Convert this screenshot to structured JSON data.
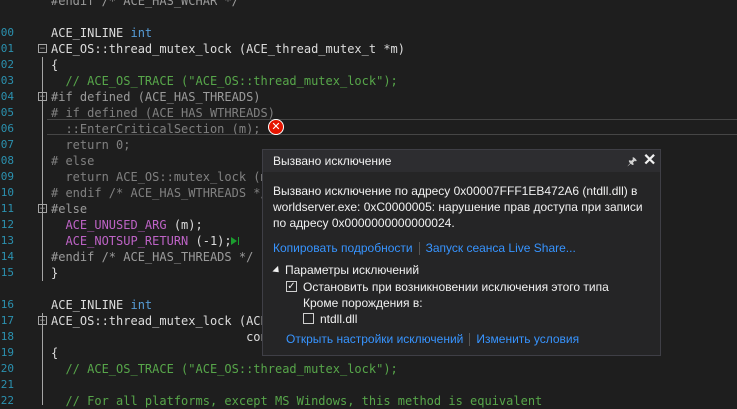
{
  "editor": {
    "lines": [
      {
        "n": "",
        "fold": "",
        "segs": [
          {
            "c": "pp",
            "t": "#endif /* ACE_HAS_WCHAR */"
          }
        ]
      },
      {
        "n": "",
        "fold": "",
        "segs": []
      },
      {
        "n": "00",
        "fold": "",
        "segs": [
          {
            "c": "",
            "t": "ACE_INLINE "
          },
          {
            "c": "kw",
            "t": "int"
          }
        ]
      },
      {
        "n": "01",
        "fold": "−",
        "segs": [
          {
            "c": "",
            "t": "ACE_OS::thread_mutex_lock (ACE_thread_mutex_t *m)"
          }
        ]
      },
      {
        "n": "02",
        "fold": "",
        "segs": [
          {
            "c": "",
            "t": "{"
          }
        ]
      },
      {
        "n": "03",
        "fold": "",
        "segs": [
          {
            "c": "cm",
            "t": "  // ACE_OS_TRACE (\"ACE_OS::thread_mutex_lock\");"
          }
        ]
      },
      {
        "n": "04",
        "fold": "−",
        "segs": [
          {
            "c": "pp",
            "t": "#if defined (ACE_HAS_THREADS)"
          }
        ]
      },
      {
        "n": "05",
        "fold": "",
        "segs": [
          {
            "c": "gr",
            "t": "# if defined (ACE_HAS_WTHREADS)"
          }
        ]
      },
      {
        "n": "06",
        "fold": "",
        "segs": [
          {
            "c": "gr",
            "t": "  ::EnterCriticalSection (m);"
          }
        ]
      },
      {
        "n": "07",
        "fold": "",
        "segs": [
          {
            "c": "gr",
            "t": "  return 0;"
          }
        ]
      },
      {
        "n": "08",
        "fold": "",
        "segs": [
          {
            "c": "gr",
            "t": "# else"
          }
        ]
      },
      {
        "n": "09",
        "fold": "",
        "segs": [
          {
            "c": "gr",
            "t": "  return ACE_OS::mutex_lock (m"
          }
        ]
      },
      {
        "n": "10",
        "fold": "",
        "segs": [
          {
            "c": "gr",
            "t": "# endif /* ACE_HAS_WTHREADS */"
          }
        ]
      },
      {
        "n": "11",
        "fold": "−",
        "segs": [
          {
            "c": "pp",
            "t": "#else"
          }
        ]
      },
      {
        "n": "12",
        "fold": "",
        "segs": [
          {
            "c": "mac",
            "t": "  ACE_UNUSED_ARG"
          },
          {
            "c": "",
            "t": " (m);"
          }
        ]
      },
      {
        "n": "13",
        "fold": "",
        "segs": [
          {
            "c": "mac",
            "t": "  ACE_NOTSUP_RETURN"
          },
          {
            "c": "",
            "t": " (-1);"
          }
        ]
      },
      {
        "n": "14",
        "fold": "",
        "segs": [
          {
            "c": "pp",
            "t": "#endif /* ACE_HAS_THREADS */"
          }
        ]
      },
      {
        "n": "15",
        "fold": "",
        "segs": [
          {
            "c": "",
            "t": "}"
          }
        ]
      },
      {
        "n": "",
        "fold": "",
        "segs": []
      },
      {
        "n": "16",
        "fold": "",
        "segs": [
          {
            "c": "",
            "t": "ACE_INLINE "
          },
          {
            "c": "kw",
            "t": "int"
          }
        ]
      },
      {
        "n": "17",
        "fold": "−",
        "segs": [
          {
            "c": "",
            "t": "ACE_OS::thread_mutex_lock (ACE"
          }
        ]
      },
      {
        "n": "18",
        "fold": "",
        "segs": [
          {
            "c": "",
            "t": "                           con"
          }
        ]
      },
      {
        "n": "19",
        "fold": "",
        "segs": [
          {
            "c": "",
            "t": "{"
          }
        ]
      },
      {
        "n": "20",
        "fold": "",
        "segs": [
          {
            "c": "cm",
            "t": "  // ACE_OS_TRACE (\"ACE_OS::thread_mutex_lock\");"
          }
        ]
      },
      {
        "n": "21",
        "fold": "",
        "segs": []
      },
      {
        "n": "22",
        "fold": "",
        "segs": [
          {
            "c": "cm",
            "t": "  // For all platforms, except MS Windows, this method is equivalent"
          }
        ]
      }
    ]
  },
  "icons": {
    "error": "error-circle-icon",
    "next_statement": "next-statement-arrow-icon"
  },
  "popup": {
    "title": "Вызвано исключение",
    "pin_icon": "pin-icon",
    "close_icon": "close-icon",
    "message_line1": "Вызвано исключение по адресу 0x00007FFF1EB472A6 (ntdll.dll) в",
    "message_line2": "worldserver.exe: 0xC0000005: нарушение прав доступа при записи",
    "message_line3": "по адресу 0x0000000000000024.",
    "copy_details": "Копировать подробности",
    "live_share": "Запуск сеанса Live Share...",
    "section_title": "Параметры исключений",
    "break_when_thrown": "Остановить при возникновении исключения этого типа",
    "break_checked": true,
    "except_when": "Кроме порождения в:",
    "ntdll_label": "ntdll.dll",
    "ntdll_checked": false,
    "open_settings": "Открыть настройки исключений",
    "edit_conditions": "Изменить условия"
  },
  "colors": {
    "error": "#e51400",
    "link": "#3794ff",
    "line_number": "#2b91af"
  }
}
